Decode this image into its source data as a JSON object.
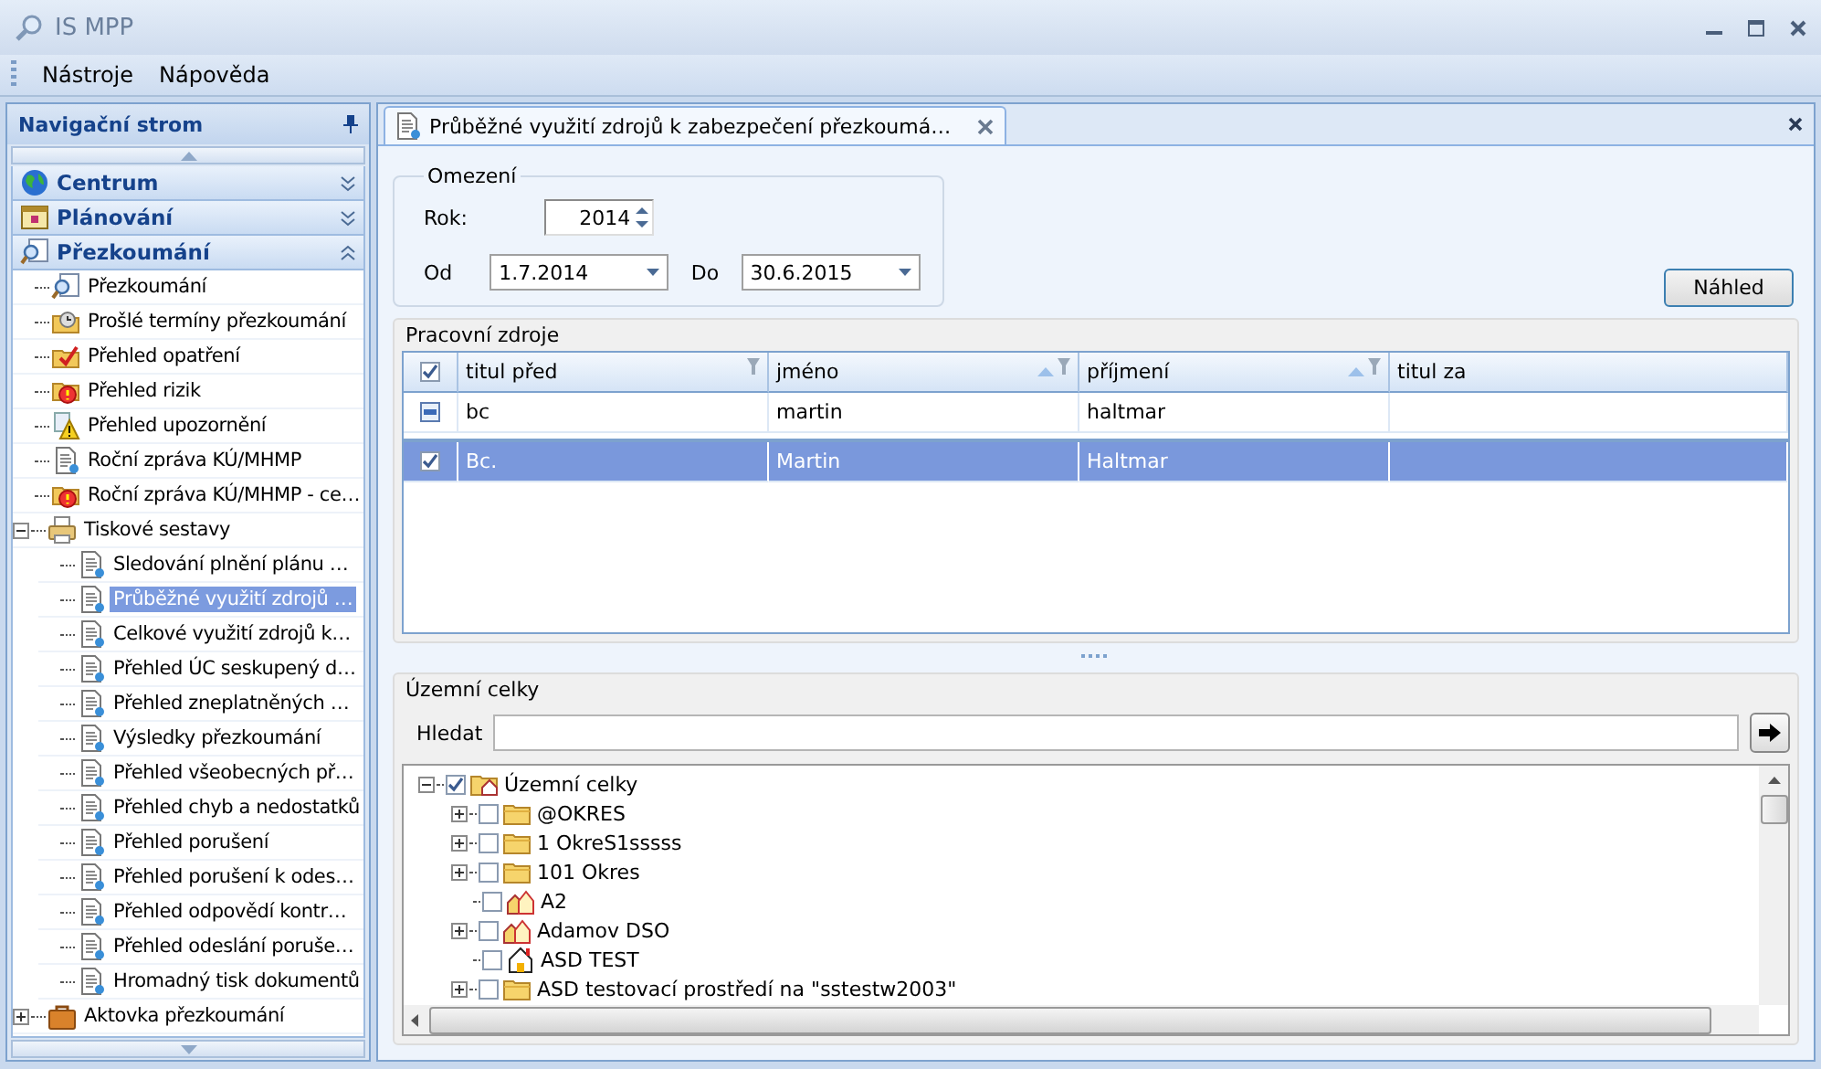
{
  "window": {
    "title": "IS MPP"
  },
  "menu": [
    {
      "label": "Nástroje"
    },
    {
      "label": "Nápověda"
    }
  ],
  "navigation": {
    "title": "Navigační strom",
    "groups": [
      {
        "label": "Centrum",
        "kind": "globe",
        "expanded": false
      },
      {
        "label": "Plánování",
        "kind": "calendar",
        "expanded": false
      },
      {
        "label": "Přezkoumání",
        "kind": "magnifier",
        "expanded": true,
        "items": [
          {
            "label": "Přezkoumání",
            "kind": "magnifier",
            "selected": false
          },
          {
            "label": "Prošlé termíny přezkoumání",
            "kind": "clock-folder",
            "selected": false
          },
          {
            "label": "Přehled opatření",
            "kind": "check-folder",
            "selected": false
          },
          {
            "label": "Přehled rizik",
            "kind": "warning-folder",
            "selected": false
          },
          {
            "label": "Přehled upozornění",
            "kind": "warning",
            "selected": false
          },
          {
            "label": "Roční zpráva KÚ/MHMP",
            "kind": "document",
            "selected": false
          },
          {
            "label": "Roční zpráva KÚ/MHMP - ce…",
            "kind": "warning-folder",
            "selected": false
          },
          {
            "label": "Tiskové sestavy",
            "kind": "printer",
            "selected": false,
            "expanded": true,
            "children": [
              {
                "label": "Sledování plnění plánu …",
                "kind": "document",
                "selected": false
              },
              {
                "label": "Průběžné využití zdrojů …",
                "kind": "document",
                "selected": true
              },
              {
                "label": "Celkové využití zdrojů k…",
                "kind": "document",
                "selected": false
              },
              {
                "label": "Přehled ÚC seskupený d…",
                "kind": "document",
                "selected": false
              },
              {
                "label": "Přehled zneplatněných …",
                "kind": "document",
                "selected": false
              },
              {
                "label": "Výsledky přezkoumání",
                "kind": "document",
                "selected": false
              },
              {
                "label": "Přehled všeobecných př…",
                "kind": "document",
                "selected": false
              },
              {
                "label": "Přehled chyb a nedostatků",
                "kind": "document",
                "selected": false
              },
              {
                "label": "Přehled porušení",
                "kind": "document",
                "selected": false
              },
              {
                "label": "Přehled porušení k odes…",
                "kind": "document",
                "selected": false
              },
              {
                "label": "Přehled odpovědí kontr…",
                "kind": "document",
                "selected": false
              },
              {
                "label": "Přehled odeslání poruše…",
                "kind": "document",
                "selected": false
              },
              {
                "label": "Hromadný tisk dokumentů",
                "kind": "document",
                "selected": false
              }
            ]
          },
          {
            "label": "Aktovka přezkoumání",
            "kind": "briefcase",
            "selected": false,
            "expanded": false
          }
        ]
      }
    ]
  },
  "tabs": [
    {
      "label": "Průběžné využití zdrojů k zabezpečení přezkoumá…",
      "selected": true
    }
  ],
  "limits": {
    "title": "Omezení",
    "year_label": "Rok:",
    "year": "2014",
    "from_label": "Od",
    "from": "1.7.2014",
    "to_label": "Do",
    "to": "30.6.2015"
  },
  "preview_button": "Náhled",
  "resources": {
    "title": "Pracovní zdroje",
    "header_checked": true,
    "columns": [
      {
        "label": "titul před",
        "sorted": false,
        "filter": true
      },
      {
        "label": "jméno",
        "sorted": true,
        "filter": true
      },
      {
        "label": "příjmení",
        "sorted": true,
        "filter": true
      },
      {
        "label": "titul za",
        "sorted": false,
        "filter": false
      }
    ],
    "rows": [
      {
        "kind": "new",
        "cells": [
          "bc",
          "martin",
          "haltmar"
        ],
        "selected": false
      },
      {
        "kind": "data",
        "checked": true,
        "cells": [
          "Bc.",
          "Martin",
          "Haltmar"
        ],
        "selected": true
      }
    ]
  },
  "regions": {
    "title": "Územní celky",
    "search_label": "Hledat",
    "tree": [
      {
        "label": "Územní celky",
        "kind": "folder-house",
        "checked": true,
        "expanded": true,
        "children": [
          {
            "label": "@OKRES",
            "kind": "folder",
            "checked": false,
            "expanded": false
          },
          {
            "label": "1 OkreS1sssss",
            "kind": "folder",
            "checked": false,
            "expanded": false
          },
          {
            "label": "101 Okres",
            "kind": "folder",
            "checked": false,
            "expanded": false
          },
          {
            "label": "A2",
            "kind": "houses",
            "checked": false
          },
          {
            "label": "Adamov DSO",
            "kind": "houses",
            "checked": false,
            "expanded": false
          },
          {
            "label": "ASD TEST",
            "kind": "house",
            "checked": false
          },
          {
            "label": "ASD testovací prostředí na \"sstestw2003\"",
            "kind": "folder",
            "checked": false,
            "expanded": false
          }
        ]
      }
    ]
  }
}
